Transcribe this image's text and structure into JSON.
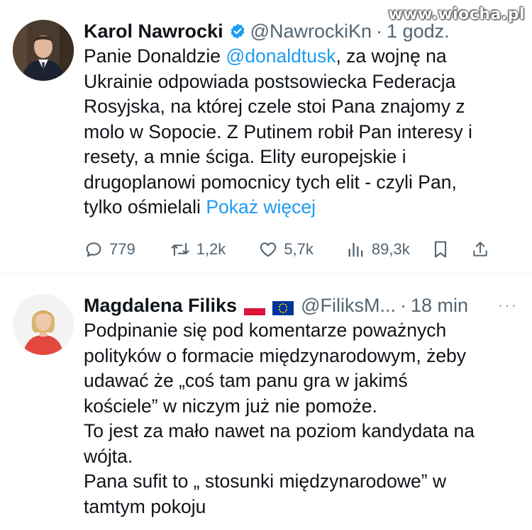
{
  "watermark": "www.wiocha.pl",
  "tweets": [
    {
      "author_name": "Karol Nawrocki",
      "verified": true,
      "handle": "@NawrockiKn",
      "separator": "·",
      "time": "1 godz.",
      "text_lines": [
        [
          "Panie Donaldzie ",
          "@donaldtusk",
          ", za wojnę na"
        ],
        "Ukrainie odpowiada postsowiecka Federacja",
        "Rosyjska, na której czele stoi Pana znajomy z",
        "molo w Sopocie. Z Putinem robił Pan interesy i",
        "resety, a mnie ściga. Elity europejskie i",
        "drugoplanowi pomocnicy tych elit - czyli Pan,",
        [
          "tylko ośmielali ",
          "Pokaż więcej"
        ]
      ],
      "stats": {
        "replies": "779",
        "reposts": "1,2k",
        "likes": "5,7k",
        "views": "89,3k"
      }
    },
    {
      "author_name": "Magdalena Filiks",
      "flags": [
        "poland-flag",
        "eu-flag"
      ],
      "handle": "@FiliksM...",
      "separator": "·",
      "time": "18 min",
      "more": "···",
      "text_lines": [
        "Podpinanie się pod komentarze poważnych",
        "polityków o formacie międzynarodowym, żeby",
        "udawać że „coś tam panu gra w jakimś",
        "kościele” w niczym już  nie pomoże.",
        "To jest za mało nawet na poziom kandydata na",
        "wójta.",
        "Pana sufit to „ stosunki  międzynarodowe” w",
        "tamtym pokoju"
      ]
    }
  ],
  "colors": {
    "link": "#1d9bf0",
    "muted": "#536471",
    "text": "#0f1419"
  }
}
